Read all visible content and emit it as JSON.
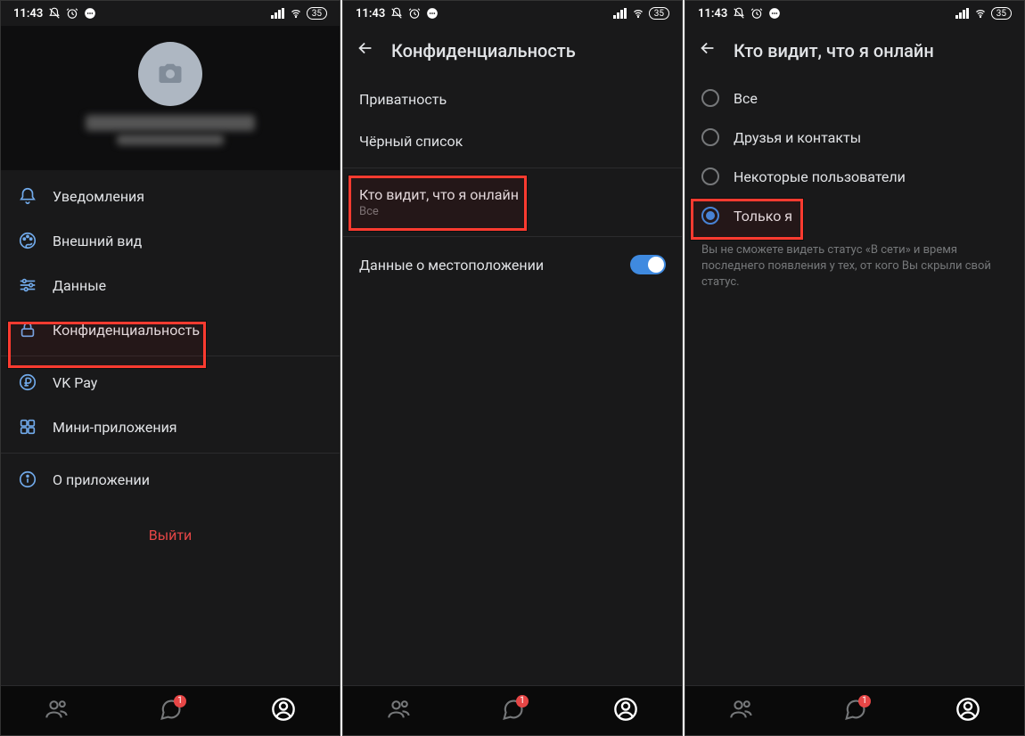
{
  "status": {
    "time": "11:43",
    "battery": "35"
  },
  "screen1": {
    "menu": {
      "notifications": "Уведомления",
      "appearance": "Внешний вид",
      "data": "Данные",
      "privacy": "Конфиденциальность",
      "vkpay": "VK Pay",
      "miniapps": "Мини-приложения",
      "about": "О приложении"
    },
    "logout": "Выйти"
  },
  "screen2": {
    "title": "Конфиденциальность",
    "rows": {
      "privacy": "Приватность",
      "blacklist": "Чёрный список",
      "online_seen": "Кто видит, что я онлайн",
      "online_seen_sub": "Все",
      "location": "Данные о местоположении"
    }
  },
  "screen3": {
    "title": "Кто видит, что я онлайн",
    "options": {
      "all": "Все",
      "friends": "Друзья и контакты",
      "some": "Некоторые пользователи",
      "only_me": "Только я"
    },
    "help": "Вы не сможете видеть статус «В сети» и время последнего появления у тех, от кого Вы скрыли свой статус."
  },
  "nav": {
    "chat_badge": "1"
  }
}
